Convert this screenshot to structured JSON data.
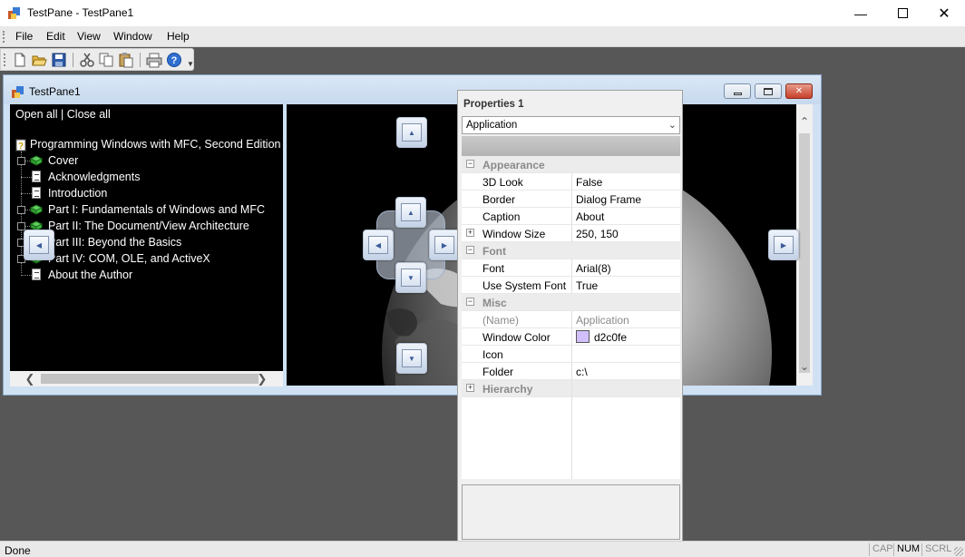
{
  "window": {
    "title": "TestPane - TestPane1",
    "minimize_icon": "minimize-icon",
    "maximize_icon": "maximize-icon",
    "close_icon": "close-icon"
  },
  "menu": [
    "File",
    "Edit",
    "View",
    "Window",
    "Help"
  ],
  "toolbar": {
    "buttons": [
      "new-icon",
      "open-icon",
      "save-icon",
      "cut-icon",
      "copy-icon",
      "paste-icon",
      "print-icon",
      "help-icon"
    ]
  },
  "child": {
    "title": "TestPane1",
    "tree": {
      "open_all": "Open all",
      "separator": "|",
      "close_all": "Close all",
      "root": "Programming Windows with MFC, Second Edition",
      "items": [
        {
          "label": "Cover",
          "icon": "book-icon",
          "expandable": true
        },
        {
          "label": "Acknowledgments",
          "icon": "page-icon",
          "expandable": false
        },
        {
          "label": "Introduction",
          "icon": "page-icon",
          "expandable": false
        },
        {
          "label": "Part I: Fundamentals of Windows and MFC",
          "icon": "book-icon",
          "expandable": true
        },
        {
          "label": "Part II: The Document/View Architecture",
          "icon": "book-icon",
          "expandable": true
        },
        {
          "label": "Part III: Beyond the Basics",
          "icon": "book-icon",
          "expandable": true
        },
        {
          "label": "Part IV: COM, OLE, and ActiveX",
          "icon": "book-icon",
          "expandable": true
        },
        {
          "label": "About the Author",
          "icon": "page-icon",
          "expandable": false
        }
      ]
    }
  },
  "properties": {
    "title": "Properties 1",
    "object": "Application",
    "rows": [
      {
        "type": "category",
        "name": "Appearance",
        "expanded": true
      },
      {
        "type": "prop",
        "name": "3D Look",
        "value": "False"
      },
      {
        "type": "prop",
        "name": "Border",
        "value": "Dialog Frame"
      },
      {
        "type": "prop",
        "name": "Caption",
        "value": "About"
      },
      {
        "type": "prop",
        "name": "Window Size",
        "value": "250, 150",
        "expandable": true
      },
      {
        "type": "category",
        "name": "Font",
        "expanded": true
      },
      {
        "type": "prop",
        "name": "Font",
        "value": "Arial(8)"
      },
      {
        "type": "prop",
        "name": "Use System Font",
        "value": "True"
      },
      {
        "type": "category",
        "name": "Misc",
        "expanded": true
      },
      {
        "type": "prop",
        "name": "(Name)",
        "value": "Application",
        "disabled": true
      },
      {
        "type": "prop",
        "name": "Window Color",
        "value": "d2c0fe",
        "color": "#d2c0fe"
      },
      {
        "type": "prop",
        "name": "Icon",
        "value": ""
      },
      {
        "type": "prop",
        "name": "Folder",
        "value": "c:\\"
      },
      {
        "type": "category",
        "name": "Hierarchy",
        "expanded": false
      }
    ]
  },
  "status": {
    "text": "Done",
    "indicators": [
      "CAP",
      "NUM",
      "SCRL"
    ]
  },
  "colors": {
    "workspace": "#575757",
    "pane_bg": "#000000",
    "accent": "#3b5b9a"
  }
}
